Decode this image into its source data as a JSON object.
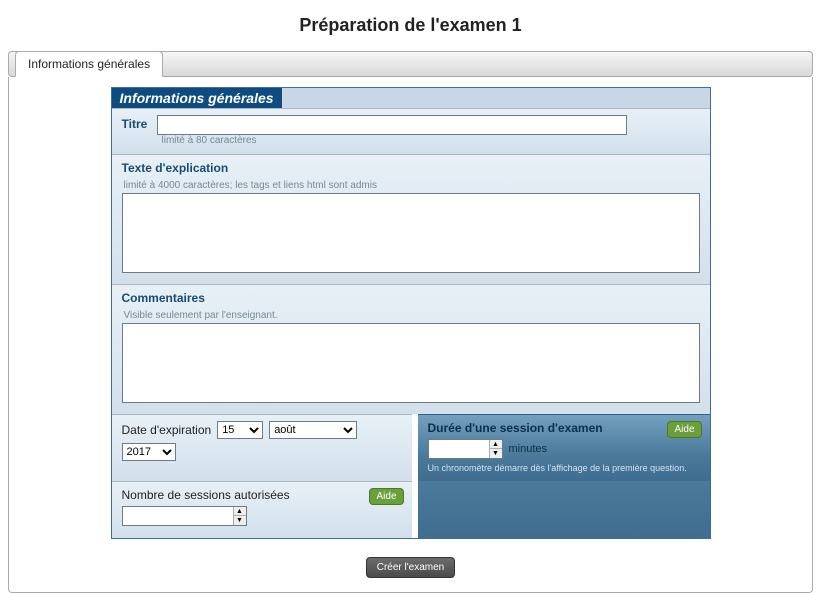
{
  "page_title": "Préparation de l'examen 1",
  "tab_label": "Informations générales",
  "panel_header": "Informations générales",
  "title_section": {
    "label": "Titre",
    "value": "",
    "hint": "limité à 80 caractères"
  },
  "explanation_section": {
    "label": "Texte d'explication",
    "hint": "limité à 4000 caractères; les tags et liens html sont admis",
    "value": ""
  },
  "comments_section": {
    "label": "Commentaires",
    "hint": "Visible seulement par l'enseignant.",
    "value": ""
  },
  "expiration": {
    "label": "Date d'expiration",
    "day": "15",
    "month": "août",
    "year": "2017"
  },
  "duration": {
    "label": "Durée d'une session d'examen",
    "value": "",
    "unit": "minutes",
    "hint": "Un chronomètre démarre dès l'affichage de la première question.",
    "help": "Aide"
  },
  "sessions": {
    "label": "Nombre de sessions autorisées",
    "value": "",
    "help": "Aide"
  },
  "create_button": "Créer l'examen"
}
